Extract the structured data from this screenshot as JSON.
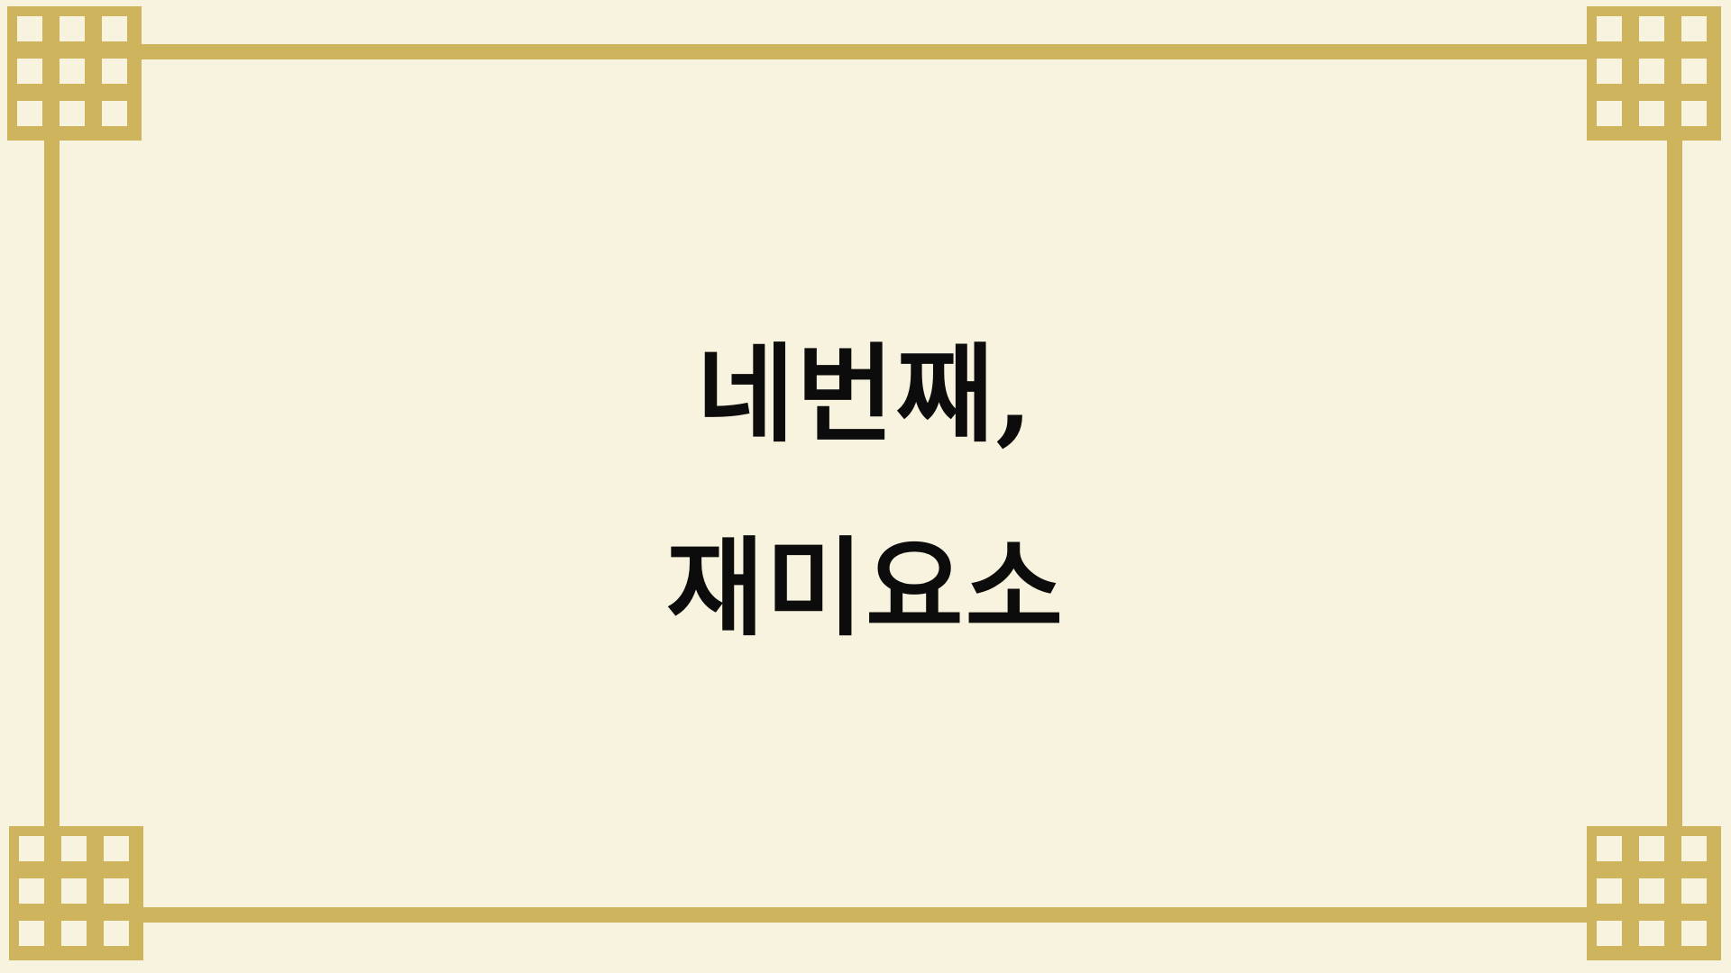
{
  "slide": {
    "title_line1": "네번째,",
    "title_line2": "재미요소"
  },
  "colors": {
    "background": "#F8F3DE",
    "frame": "#CEB45C",
    "text": "#0C0C0C"
  }
}
